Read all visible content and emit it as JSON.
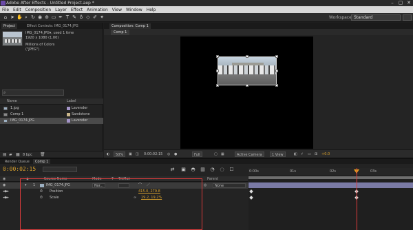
{
  "window": {
    "title": "Adobe After Effects - Untitled Project.aep *",
    "controls": [
      "–",
      "▢",
      "✕"
    ]
  },
  "menu": [
    "File",
    "Edit",
    "Composition",
    "Layer",
    "Effect",
    "Animation",
    "View",
    "Window",
    "Help"
  ],
  "workspace": {
    "label": "Workspace:",
    "value": "Standard"
  },
  "project_panel": {
    "tabs": [
      "Project",
      "Effect Controls: IMG_0174.JPG"
    ],
    "selected_item": {
      "name": "IMG_0174.JPG▾",
      "usage": ", used 1 time",
      "dimensions": "1920 x 1080 (1.00)",
      "colors": "Millions of Colors",
      "format": "(\"JPEG\")"
    },
    "search_icon": "search-icon",
    "columns": [
      "Name",
      "Label"
    ],
    "items": [
      {
        "name": "1.jpg",
        "label": "Lavender",
        "label_color": "#a494c8",
        "icon": "image-icon"
      },
      {
        "name": "Comp 1",
        "label": "Sandstone",
        "label_color": "#c8b58a",
        "icon": "composition-icon"
      },
      {
        "name": "IMG_0174.JPG",
        "label": "Lavender",
        "label_color": "#a494c8",
        "icon": "image-icon"
      }
    ],
    "footer": {
      "bpc": "8 bpc"
    }
  },
  "comp_panel": {
    "tab": "Composition: Comp 1",
    "subtab": "Comp 1",
    "zoom": "50%",
    "timecode": "0:00:02:15",
    "resolution": "Full",
    "camera": "Active Camera",
    "view": "1 View",
    "exposure": "+0.0"
  },
  "timeline": {
    "tabs": [
      "Render Queue",
      "Comp 1"
    ],
    "timecode": "0:00:02:15",
    "columns": {
      "source": "Source Name",
      "mode": "Mode",
      "t": "T",
      "trkmat": "TrkMat",
      "parent": "Parent"
    },
    "layer": {
      "num": "1",
      "name": "IMG_0174.JPG",
      "mode": "Nor...",
      "parent": "None"
    },
    "properties": [
      {
        "name": "Position",
        "value": "415.0, 279.8"
      },
      {
        "name": "Scale",
        "value": "19.2, 19.2%"
      }
    ],
    "ruler": [
      "0:00s",
      "01s",
      "02s",
      "03s"
    ],
    "accent_color": "#d9a12c"
  }
}
